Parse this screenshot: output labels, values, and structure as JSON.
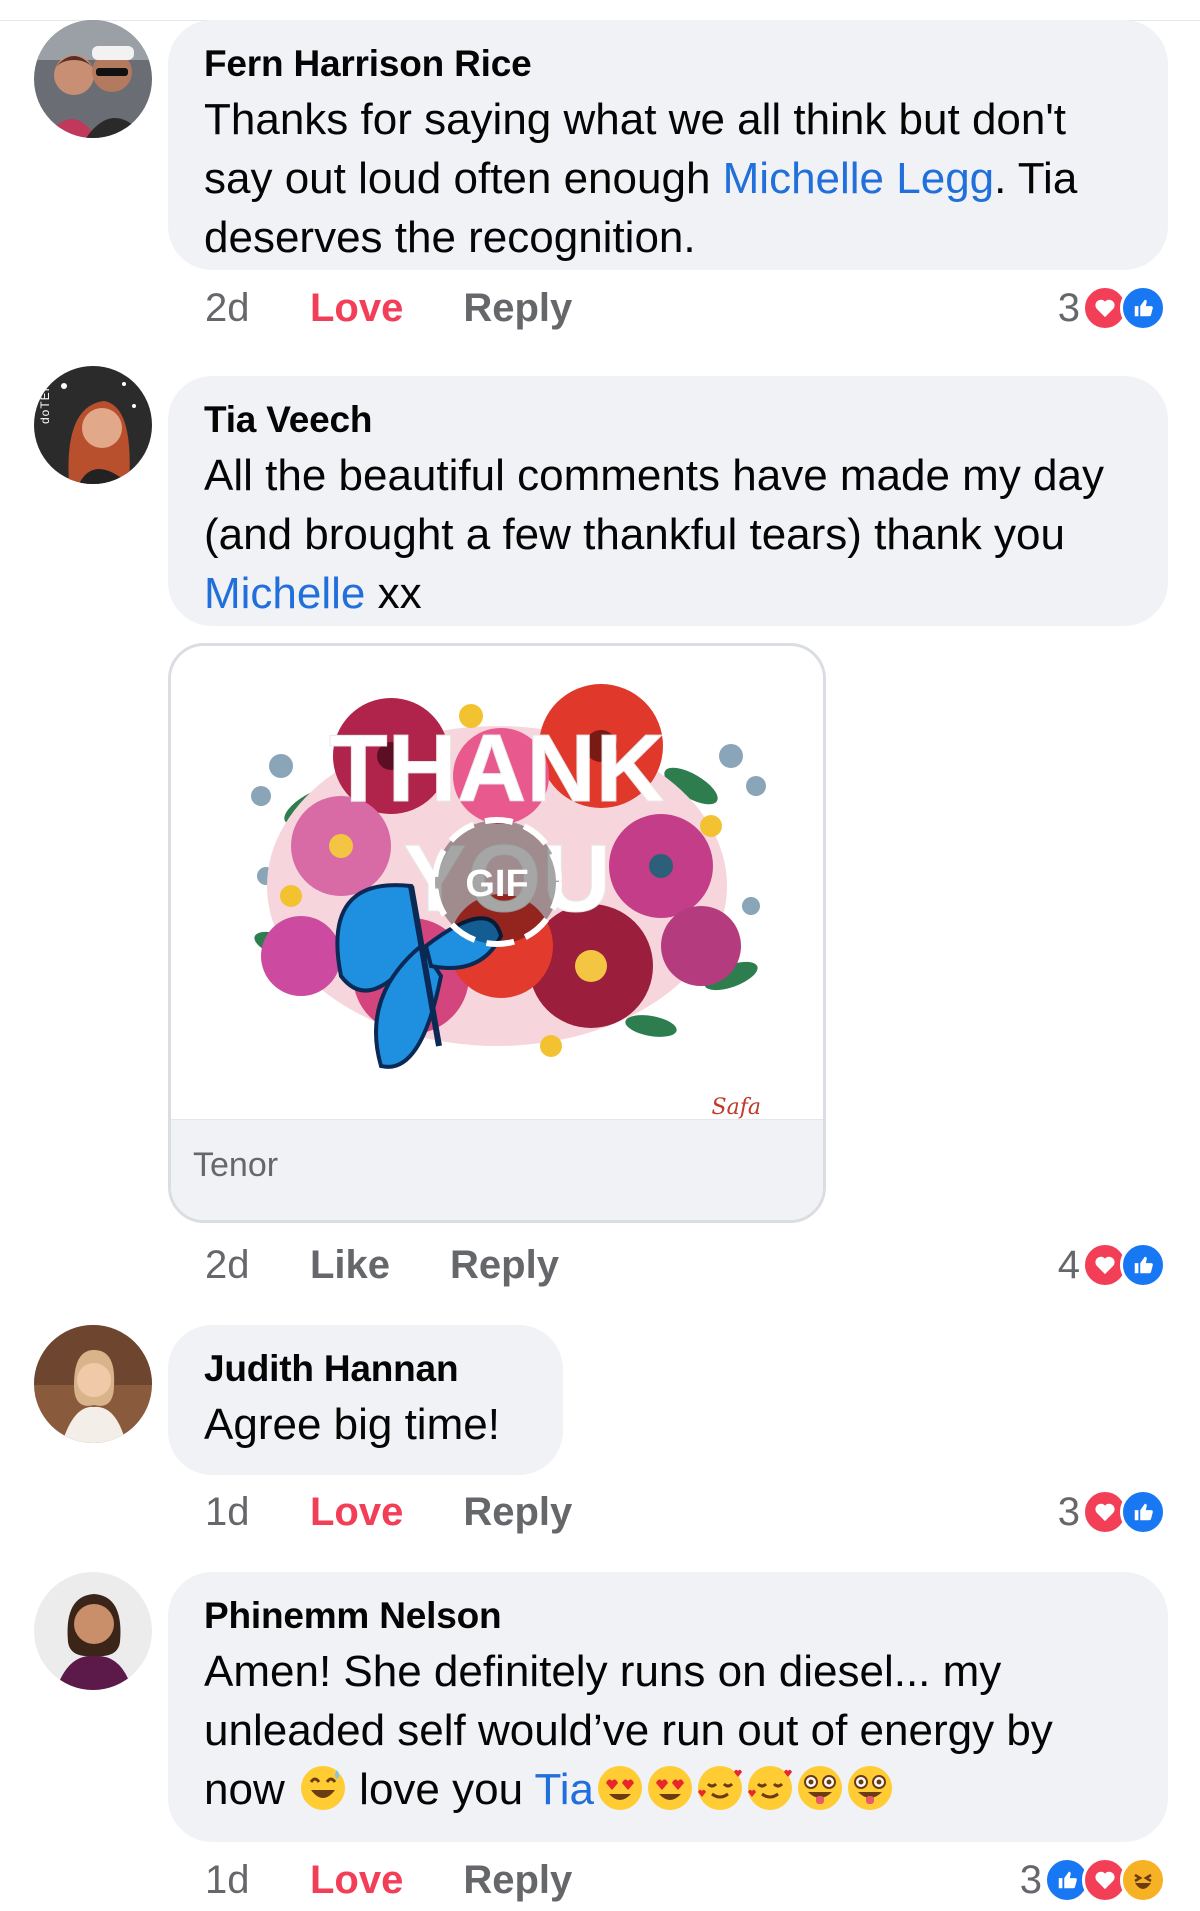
{
  "comments": [
    {
      "author": "Fern Harrison Rice",
      "text_parts": [
        "Thanks for saying what we all think but don't say out loud often enough ",
        "Michelle Legg",
        ". Tia deserves the recognition."
      ],
      "time": "2d",
      "reaction_action": "Love",
      "reply": "Reply",
      "reaction_count": "3",
      "reaction_icons": [
        "love-icon",
        "like-icon"
      ]
    },
    {
      "author": "Tia Veech",
      "text_parts": [
        "All the beautiful comments have made my day (and brought a few thankful tears) thank you ",
        "Michelle",
        " xx"
      ],
      "avatar_badge": "doTER",
      "gif": {
        "title_line1": "THANK",
        "title_line2": "YOU",
        "badge": "GIF",
        "signature": "Safa",
        "source": "Tenor"
      },
      "time": "2d",
      "reaction_action": "Like",
      "reply": "Reply",
      "reaction_count": "4",
      "reaction_icons": [
        "love-icon",
        "like-icon"
      ]
    },
    {
      "author": "Judith Hannan",
      "text_parts": [
        "Agree big time!"
      ],
      "time": "1d",
      "reaction_action": "Love",
      "reply": "Reply",
      "reaction_count": "3",
      "reaction_icons": [
        "love-icon",
        "like-icon"
      ]
    },
    {
      "author": "Phinemm Nelson",
      "text_parts": [
        "Amen! She definitely runs on diesel... my unleaded self would’ve run out of energy by now ",
        " love you ",
        "Tia"
      ],
      "time": "1d",
      "reaction_action": "Love",
      "reply": "Reply",
      "reaction_count": "3",
      "reaction_icons": [
        "like-icon",
        "love-icon",
        "haha-icon"
      ],
      "emojis": [
        "sweat-smile-emoji",
        "heart-eyes-emoji",
        "heart-eyes-emoji",
        "smiling-hearts-emoji",
        "smiling-hearts-emoji",
        "zany-face-emoji",
        "zany-face-emoji"
      ]
    }
  ],
  "colors": {
    "mention": "#216fdb",
    "love": "#f33e58",
    "like": "#1877f2",
    "bubble": "#f0f2f5",
    "meta": "#65676b"
  }
}
